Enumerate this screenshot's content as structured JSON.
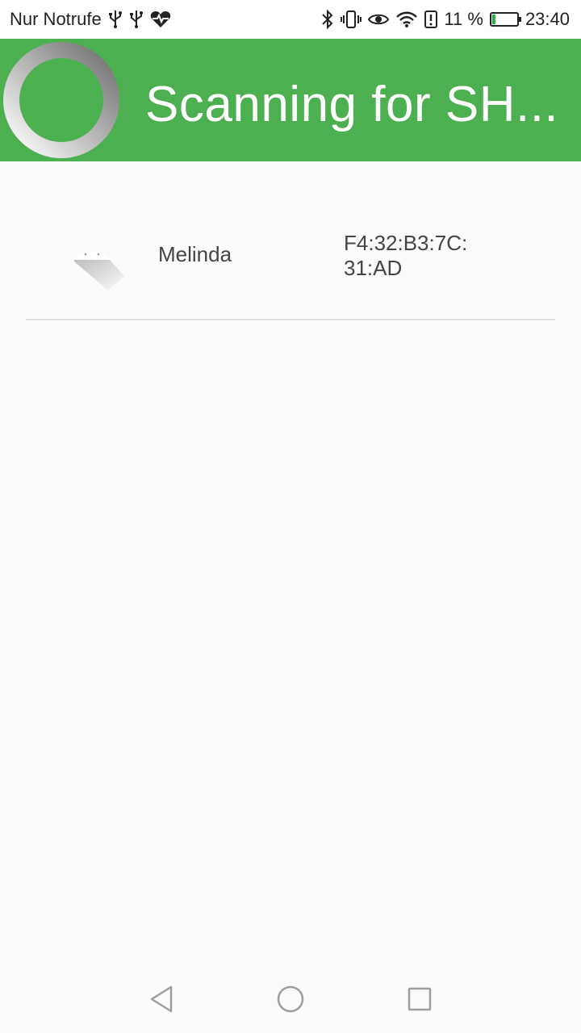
{
  "status_bar": {
    "carrier": "Nur Notrufe",
    "battery_percent": "11 %",
    "battery_level": 0.11,
    "time": "23:40",
    "icons_left": [
      "usb-icon",
      "usb-icon",
      "heart-rate-icon"
    ],
    "icons_right": [
      "bluetooth-icon",
      "vibrate-icon",
      "eye-icon",
      "wifi-icon",
      "alert-icon",
      "battery-charging-icon"
    ]
  },
  "app_bar": {
    "title": "Scanning for SH...",
    "background": "#4caf50"
  },
  "devices": [
    {
      "name": "Melinda",
      "address": "F4:32:B3:7C:\n31:AD"
    }
  ],
  "nav_bar": {
    "buttons": [
      "back-icon",
      "home-icon",
      "recents-icon"
    ]
  }
}
